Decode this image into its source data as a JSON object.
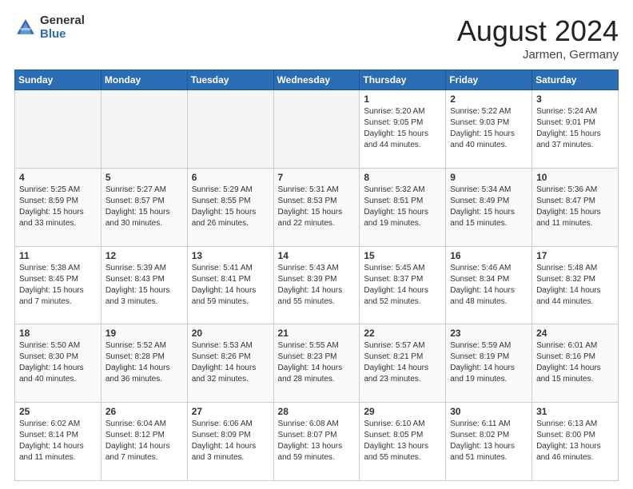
{
  "header": {
    "logo_general": "General",
    "logo_blue": "Blue",
    "month_title": "August 2024",
    "location": "Jarmen, Germany"
  },
  "weekdays": [
    "Sunday",
    "Monday",
    "Tuesday",
    "Wednesday",
    "Thursday",
    "Friday",
    "Saturday"
  ],
  "weeks": [
    [
      {
        "day": "",
        "text": ""
      },
      {
        "day": "",
        "text": ""
      },
      {
        "day": "",
        "text": ""
      },
      {
        "day": "",
        "text": ""
      },
      {
        "day": "1",
        "text": "Sunrise: 5:20 AM\nSunset: 9:05 PM\nDaylight: 15 hours\nand 44 minutes."
      },
      {
        "day": "2",
        "text": "Sunrise: 5:22 AM\nSunset: 9:03 PM\nDaylight: 15 hours\nand 40 minutes."
      },
      {
        "day": "3",
        "text": "Sunrise: 5:24 AM\nSunset: 9:01 PM\nDaylight: 15 hours\nand 37 minutes."
      }
    ],
    [
      {
        "day": "4",
        "text": "Sunrise: 5:25 AM\nSunset: 8:59 PM\nDaylight: 15 hours\nand 33 minutes."
      },
      {
        "day": "5",
        "text": "Sunrise: 5:27 AM\nSunset: 8:57 PM\nDaylight: 15 hours\nand 30 minutes."
      },
      {
        "day": "6",
        "text": "Sunrise: 5:29 AM\nSunset: 8:55 PM\nDaylight: 15 hours\nand 26 minutes."
      },
      {
        "day": "7",
        "text": "Sunrise: 5:31 AM\nSunset: 8:53 PM\nDaylight: 15 hours\nand 22 minutes."
      },
      {
        "day": "8",
        "text": "Sunrise: 5:32 AM\nSunset: 8:51 PM\nDaylight: 15 hours\nand 19 minutes."
      },
      {
        "day": "9",
        "text": "Sunrise: 5:34 AM\nSunset: 8:49 PM\nDaylight: 15 hours\nand 15 minutes."
      },
      {
        "day": "10",
        "text": "Sunrise: 5:36 AM\nSunset: 8:47 PM\nDaylight: 15 hours\nand 11 minutes."
      }
    ],
    [
      {
        "day": "11",
        "text": "Sunrise: 5:38 AM\nSunset: 8:45 PM\nDaylight: 15 hours\nand 7 minutes."
      },
      {
        "day": "12",
        "text": "Sunrise: 5:39 AM\nSunset: 8:43 PM\nDaylight: 15 hours\nand 3 minutes."
      },
      {
        "day": "13",
        "text": "Sunrise: 5:41 AM\nSunset: 8:41 PM\nDaylight: 14 hours\nand 59 minutes."
      },
      {
        "day": "14",
        "text": "Sunrise: 5:43 AM\nSunset: 8:39 PM\nDaylight: 14 hours\nand 55 minutes."
      },
      {
        "day": "15",
        "text": "Sunrise: 5:45 AM\nSunset: 8:37 PM\nDaylight: 14 hours\nand 52 minutes."
      },
      {
        "day": "16",
        "text": "Sunrise: 5:46 AM\nSunset: 8:34 PM\nDaylight: 14 hours\nand 48 minutes."
      },
      {
        "day": "17",
        "text": "Sunrise: 5:48 AM\nSunset: 8:32 PM\nDaylight: 14 hours\nand 44 minutes."
      }
    ],
    [
      {
        "day": "18",
        "text": "Sunrise: 5:50 AM\nSunset: 8:30 PM\nDaylight: 14 hours\nand 40 minutes."
      },
      {
        "day": "19",
        "text": "Sunrise: 5:52 AM\nSunset: 8:28 PM\nDaylight: 14 hours\nand 36 minutes."
      },
      {
        "day": "20",
        "text": "Sunrise: 5:53 AM\nSunset: 8:26 PM\nDaylight: 14 hours\nand 32 minutes."
      },
      {
        "day": "21",
        "text": "Sunrise: 5:55 AM\nSunset: 8:23 PM\nDaylight: 14 hours\nand 28 minutes."
      },
      {
        "day": "22",
        "text": "Sunrise: 5:57 AM\nSunset: 8:21 PM\nDaylight: 14 hours\nand 23 minutes."
      },
      {
        "day": "23",
        "text": "Sunrise: 5:59 AM\nSunset: 8:19 PM\nDaylight: 14 hours\nand 19 minutes."
      },
      {
        "day": "24",
        "text": "Sunrise: 6:01 AM\nSunset: 8:16 PM\nDaylight: 14 hours\nand 15 minutes."
      }
    ],
    [
      {
        "day": "25",
        "text": "Sunrise: 6:02 AM\nSunset: 8:14 PM\nDaylight: 14 hours\nand 11 minutes."
      },
      {
        "day": "26",
        "text": "Sunrise: 6:04 AM\nSunset: 8:12 PM\nDaylight: 14 hours\nand 7 minutes."
      },
      {
        "day": "27",
        "text": "Sunrise: 6:06 AM\nSunset: 8:09 PM\nDaylight: 14 hours\nand 3 minutes."
      },
      {
        "day": "28",
        "text": "Sunrise: 6:08 AM\nSunset: 8:07 PM\nDaylight: 13 hours\nand 59 minutes."
      },
      {
        "day": "29",
        "text": "Sunrise: 6:10 AM\nSunset: 8:05 PM\nDaylight: 13 hours\nand 55 minutes."
      },
      {
        "day": "30",
        "text": "Sunrise: 6:11 AM\nSunset: 8:02 PM\nDaylight: 13 hours\nand 51 minutes."
      },
      {
        "day": "31",
        "text": "Sunrise: 6:13 AM\nSunset: 8:00 PM\nDaylight: 13 hours\nand 46 minutes."
      }
    ]
  ]
}
